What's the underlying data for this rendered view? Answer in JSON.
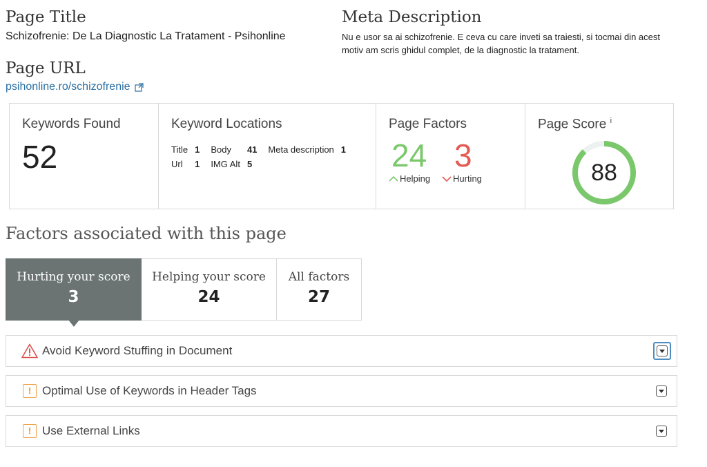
{
  "page_title": {
    "label": "Page Title",
    "value": "Schizofrenie: De La Diagnostic La Tratament - Psihonline"
  },
  "meta_description": {
    "label": "Meta Description",
    "value": "Nu e usor sa ai schizofrenie. E ceva cu care inveti sa traiesti, si tocmai din acest motiv am scris ghidul complet, de la diagnostic la tratament."
  },
  "page_url": {
    "label": "Page URL",
    "value": "psihonline.ro/schizofrenie",
    "icon": "external-link-icon"
  },
  "stats": {
    "keywords_found": {
      "title": "Keywords Found",
      "value": "52"
    },
    "keyword_locations": {
      "title": "Keyword Locations",
      "items": [
        {
          "label": "Title",
          "count": "1"
        },
        {
          "label": "Body",
          "count": "41"
        },
        {
          "label": "Meta description",
          "count": "1"
        },
        {
          "label": "Url",
          "count": "1"
        },
        {
          "label": "IMG Alt",
          "count": "5"
        }
      ]
    },
    "page_factors": {
      "title": "Page Factors",
      "helping": "24",
      "helping_label": "Helping",
      "hurting": "3",
      "hurting_label": "Hurting",
      "helping_color": "#7bc86c",
      "hurting_color": "#e35b53"
    },
    "page_score": {
      "title": "Page Score",
      "info_mark": "i",
      "value": "88",
      "fraction": 0.88,
      "ring_color": "#7bc86c",
      "track_color": "#eef1f1"
    }
  },
  "factors_heading": "Factors associated with this page",
  "tabs": [
    {
      "label": "Hurting your score",
      "count": "3",
      "active": true
    },
    {
      "label": "Helping your score",
      "count": "24",
      "active": false
    },
    {
      "label": "All factors",
      "count": "27",
      "active": false
    }
  ],
  "factor_rows": [
    {
      "label": "Avoid Keyword Stuffing in Document",
      "icon": "warning-triangle-icon",
      "severity_color": "#d9534f"
    },
    {
      "label": "Optimal Use of Keywords in Header Tags",
      "icon": "warning-box-icon",
      "severity_color": "#f0a24a"
    },
    {
      "label": "Use External Links",
      "icon": "warning-box-icon",
      "severity_color": "#f0a24a"
    }
  ]
}
